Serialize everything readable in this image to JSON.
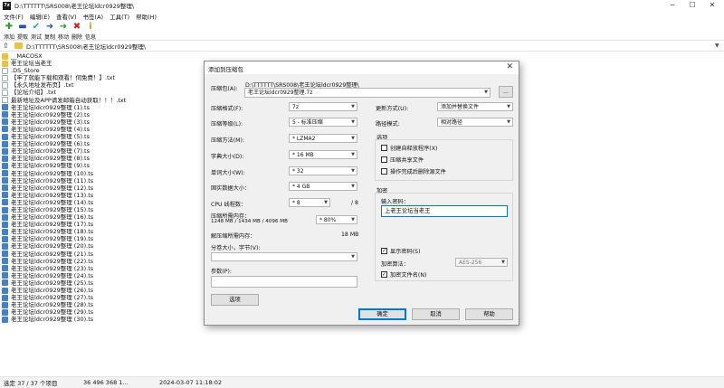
{
  "window": {
    "title": "D:\\TTTTTT\\SRS008\\老王论坛ldcr0929整理\\",
    "icon_text": "7z"
  },
  "menu": [
    "文件(F)",
    "编辑(E)",
    "查看(V)",
    "书签(A)",
    "工具(T)",
    "帮助(H)"
  ],
  "toolbar": [
    {
      "label": "添加",
      "icon": "plus-icon",
      "glyph": "✚",
      "color": "#2a9a2a"
    },
    {
      "label": "提取",
      "icon": "minus-icon",
      "glyph": "▬",
      "color": "#2255aa"
    },
    {
      "label": "测试",
      "icon": "check-icon",
      "glyph": "✔",
      "color": "#22aa99"
    },
    {
      "label": "复制",
      "icon": "copy-arrow-icon",
      "glyph": "➜",
      "color": "#2255aa"
    },
    {
      "label": "移动",
      "icon": "move-arrow-icon",
      "glyph": "➜",
      "color": "#2a9a2a"
    },
    {
      "label": "删除",
      "icon": "delete-icon",
      "glyph": "✖",
      "color": "#cc2222"
    },
    {
      "label": "信息",
      "icon": "info-icon",
      "glyph": "i",
      "color": "#c9a020"
    }
  ],
  "address": {
    "path": "D:\\TTTTTT\\SRS008\\老王论坛ldcr0929整理\\"
  },
  "files": [
    {
      "name": "__MACOSX",
      "type": "folder"
    },
    {
      "name": "老王论坛当老王",
      "type": "folder"
    },
    {
      "name": ".DS_Store",
      "type": "text"
    },
    {
      "name": "【牢了就能下载和观看！伺免费！】.txt",
      "type": "text"
    },
    {
      "name": "【永久地址发布页】.txt",
      "type": "text"
    },
    {
      "name": "【论坛介绍】.txt",
      "type": "text"
    },
    {
      "name": "最新地址及APP请发邮箱自动获取！！！.txt",
      "type": "text"
    },
    {
      "name": "老王论坛ldcr0929整理 (1).ts",
      "type": "ts"
    },
    {
      "name": "老王论坛ldcr0929整理 (2).ts",
      "type": "ts"
    },
    {
      "name": "老王论坛ldcr0929整理 (3).ts",
      "type": "ts"
    },
    {
      "name": "老王论坛ldcr0929整理 (4).ts",
      "type": "ts"
    },
    {
      "name": "老王论坛ldcr0929整理 (5).ts",
      "type": "ts"
    },
    {
      "name": "老王论坛ldcr0929整理 (6).ts",
      "type": "ts"
    },
    {
      "name": "老王论坛ldcr0929整理 (7).ts",
      "type": "ts"
    },
    {
      "name": "老王论坛ldcr0929整理 (8).ts",
      "type": "ts"
    },
    {
      "name": "老王论坛ldcr0929整理 (9).ts",
      "type": "ts"
    },
    {
      "name": "老王论坛ldcr0929整理 (10).ts",
      "type": "ts"
    },
    {
      "name": "老王论坛ldcr0929整理 (11).ts",
      "type": "ts"
    },
    {
      "name": "老王论坛ldcr0929整理 (12).ts",
      "type": "ts"
    },
    {
      "name": "老王论坛ldcr0929整理 (13).ts",
      "type": "ts"
    },
    {
      "name": "老王论坛ldcr0929整理 (14).ts",
      "type": "ts"
    },
    {
      "name": "老王论坛ldcr0929整理 (15).ts",
      "type": "ts"
    },
    {
      "name": "老王论坛ldcr0929整理 (16).ts",
      "type": "ts"
    },
    {
      "name": "老王论坛ldcr0929整理 (17).ts",
      "type": "ts"
    },
    {
      "name": "老王论坛ldcr0929整理 (18).ts",
      "type": "ts"
    },
    {
      "name": "老王论坛ldcr0929整理 (19).ts",
      "type": "ts"
    },
    {
      "name": "老王论坛ldcr0929整理 (20).ts",
      "type": "ts"
    },
    {
      "name": "老王论坛ldcr0929整理 (21).ts",
      "type": "ts"
    },
    {
      "name": "老王论坛ldcr0929整理 (22).ts",
      "type": "ts"
    },
    {
      "name": "老王论坛ldcr0929整理 (23).ts",
      "type": "ts"
    },
    {
      "name": "老王论坛ldcr0929整理 (24).ts",
      "type": "ts"
    },
    {
      "name": "老王论坛ldcr0929整理 (25).ts",
      "type": "ts"
    },
    {
      "name": "老王论坛ldcr0929整理 (26).ts",
      "type": "ts"
    },
    {
      "name": "老王论坛ldcr0929整理 (27).ts",
      "type": "ts"
    },
    {
      "name": "老王论坛ldcr0929整理 (28).ts",
      "type": "ts"
    },
    {
      "name": "老王论坛ldcr0929整理 (29).ts",
      "type": "ts"
    },
    {
      "name": "老王论坛ldcr0929整理 (30).ts",
      "type": "ts"
    }
  ],
  "status": {
    "selected": "选定 37 / 37 个项目",
    "size": "36 496 368 1...",
    "modified": "2024-03-07 11:18:02"
  },
  "dialog": {
    "title": "添加到压缩包",
    "archive_label": "压缩包(A):",
    "archive_dir": "D:\\TTTTTT\\SRS008\\老王论坛ldcr0929整理\\",
    "archive_name": "老王论坛ldcr0929整理.7z",
    "browse_label": "...",
    "format_label": "压缩格式(F):",
    "format_value": "7z",
    "level_label": "压缩等级(L):",
    "level_value": "5 - 标准压缩",
    "method_label": "压缩方法(M):",
    "method_value": "* LZMA2",
    "dict_label": "字典大小(D):",
    "dict_value": "* 16 MB",
    "word_label": "单词大小(W):",
    "word_value": "* 32",
    "solid_label": "固实数据大小：",
    "solid_value": "* 4 GB",
    "threads_label": "CPU 线程数：",
    "threads_value": "* 8",
    "threads_total": "/ 8",
    "mem_label": "压缩所需内存：",
    "mem_detail": "1248 MB / 1434 MB / 4096 MB",
    "mem_value": "* 80%",
    "decomp_label": "解压缩所需内存：",
    "decomp_value": "18 MB",
    "split_label": "分卷大小，字节(V):",
    "split_value": "",
    "params_label": "参数(P):",
    "params_value": "",
    "options_button": "选项",
    "update_label": "更新方式(U):",
    "update_value": "添加并替换文件",
    "path_label": "路径模式:",
    "path_value": "相对路径",
    "options_group": "选项",
    "opt_sfx": "创建自释放程序(X)",
    "opt_shared": "压缩共享文件",
    "opt_delete": "操作完成后删除源文件",
    "enc_group": "加密",
    "pwd_label": "输入密码：",
    "pwd_value": "上老王论坛当老王",
    "show_pwd": "显示密码(S)",
    "enc_method_label": "加密算法：",
    "enc_method_value": "AES-256",
    "enc_names": "加密文件名(N)",
    "ok": "确定",
    "cancel": "取消",
    "help": "帮助"
  }
}
